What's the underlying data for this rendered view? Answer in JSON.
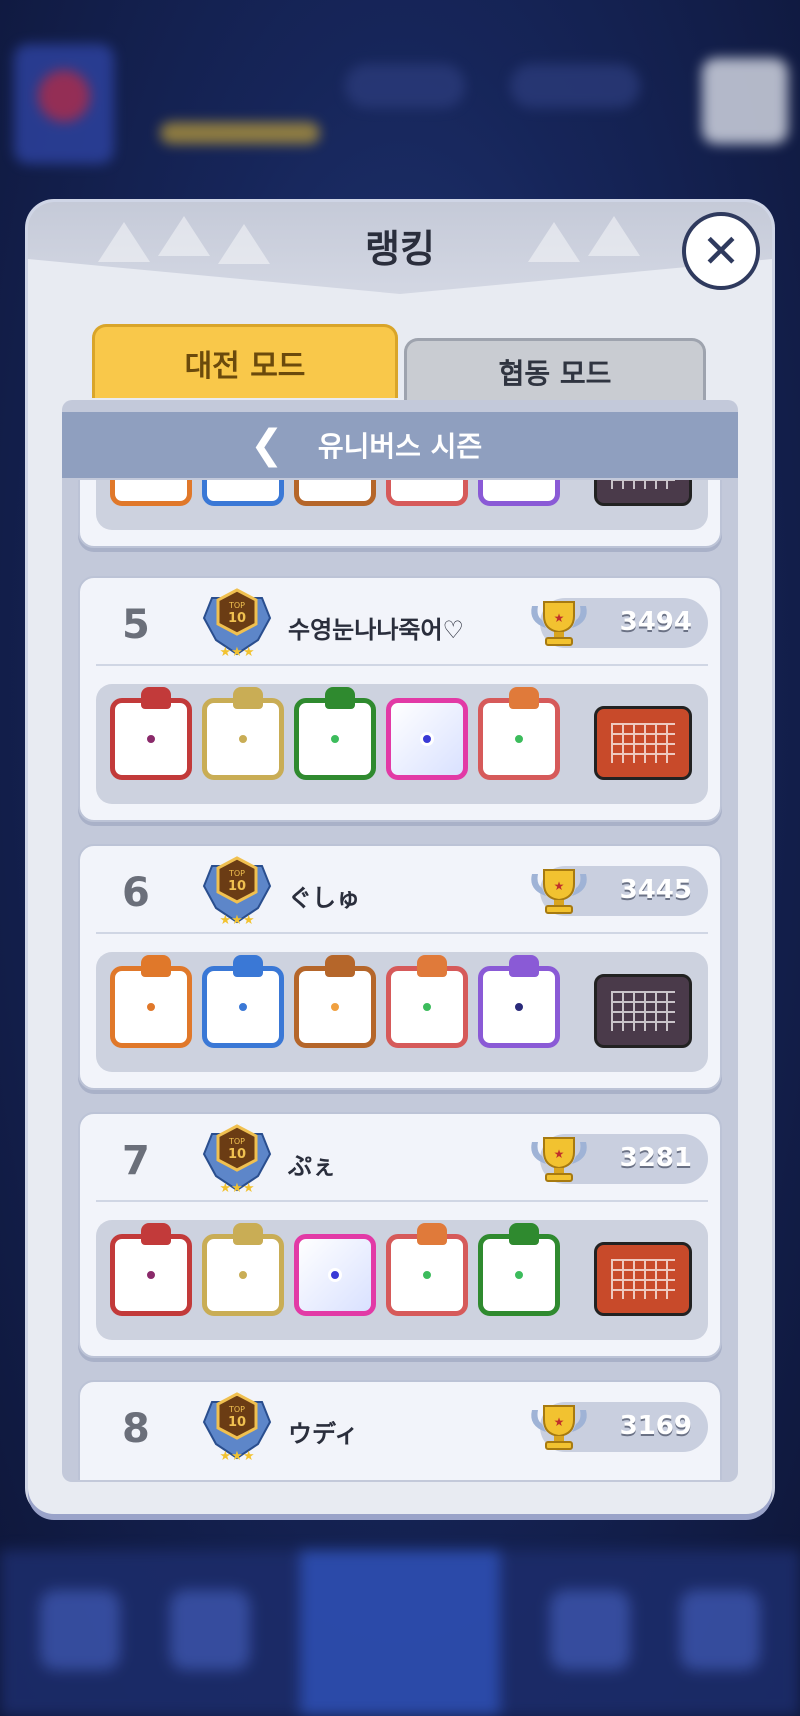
{
  "modal": {
    "title": "랭킹",
    "tabs": [
      {
        "label": "대전 모드",
        "active": true
      },
      {
        "label": "협동 모드",
        "active": false
      }
    ],
    "season": "유니버스 시즌"
  },
  "rankings": [
    {
      "rank": "5",
      "name": "수영눈나나죽어♡",
      "score": "3494",
      "deck": [
        "red-unit",
        "gold-unit",
        "green-unit",
        "pink-unit",
        "rainbow-unit",
        "map-fire"
      ]
    },
    {
      "rank": "6",
      "name": "ぐしゅ",
      "score": "3445",
      "deck": [
        "orange-unit",
        "blue-unit",
        "bronze-unit",
        "rainbow-unit",
        "violet-unit",
        "map-dark"
      ]
    },
    {
      "rank": "7",
      "name": "ぷぇ",
      "score": "3281",
      "deck": [
        "red-unit",
        "gold-unit",
        "pink-unit",
        "rainbow-unit",
        "green-unit",
        "map-fire"
      ]
    },
    {
      "rank": "8",
      "name": "ウディ",
      "score": "3169",
      "deck": []
    }
  ],
  "colors": {
    "tab_active": "#f9c84a",
    "tab_inactive": "#c9ccd2",
    "season_bar": "#8f9fbf",
    "card_bg": "#f2f4fa"
  }
}
